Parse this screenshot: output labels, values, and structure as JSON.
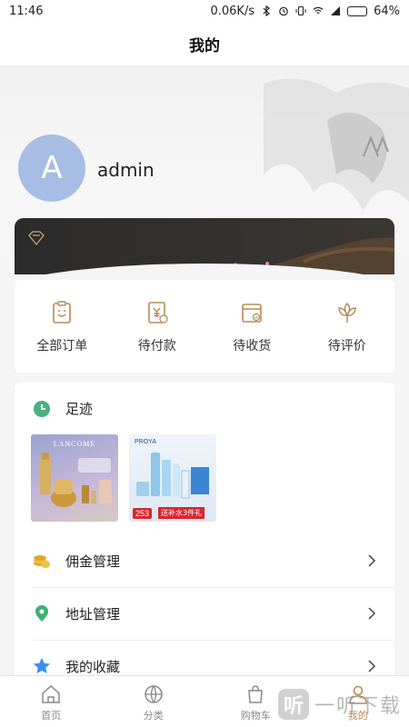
{
  "status_bar": {
    "time": "11:46",
    "speed": "0.06K/s",
    "battery": "64%",
    "battery_level": 0.64
  },
  "header": {
    "title": "我的"
  },
  "profile": {
    "avatar_letter": "A",
    "username": "admin"
  },
  "orders": [
    {
      "label": "全部订单",
      "icon": "clipboard-icon"
    },
    {
      "label": "待付款",
      "icon": "yen-bill-icon"
    },
    {
      "label": "待收货",
      "icon": "box-icon"
    },
    {
      "label": "待评价",
      "icon": "lotus-icon"
    }
  ],
  "footprint": {
    "title": "足迹",
    "products": [
      {
        "brand": "LANCOME"
      },
      {
        "brand": "PROYA",
        "price": "253",
        "promo": "送补水3件礼"
      }
    ]
  },
  "menu": [
    {
      "label": "佣金管理",
      "icon": "coins-icon"
    },
    {
      "label": "地址管理",
      "icon": "location-pin-icon"
    },
    {
      "label": "我的收藏",
      "icon": "star-icon"
    }
  ],
  "tabs": [
    {
      "label": "首页",
      "icon": "home-icon"
    },
    {
      "label": "分类",
      "icon": "category-icon"
    },
    {
      "label": "购物车",
      "icon": "cart-icon"
    },
    {
      "label": "我的",
      "icon": "user-icon",
      "active": true
    }
  ],
  "watermark": {
    "logo": "听",
    "text": "一听下载"
  },
  "colors": {
    "accent": "#b58b57",
    "avatar": "#a7bde3",
    "clock": "#4caf7d",
    "coin": "#e0a82e",
    "pin": "#3cb371",
    "star": "#3d8ef0"
  }
}
